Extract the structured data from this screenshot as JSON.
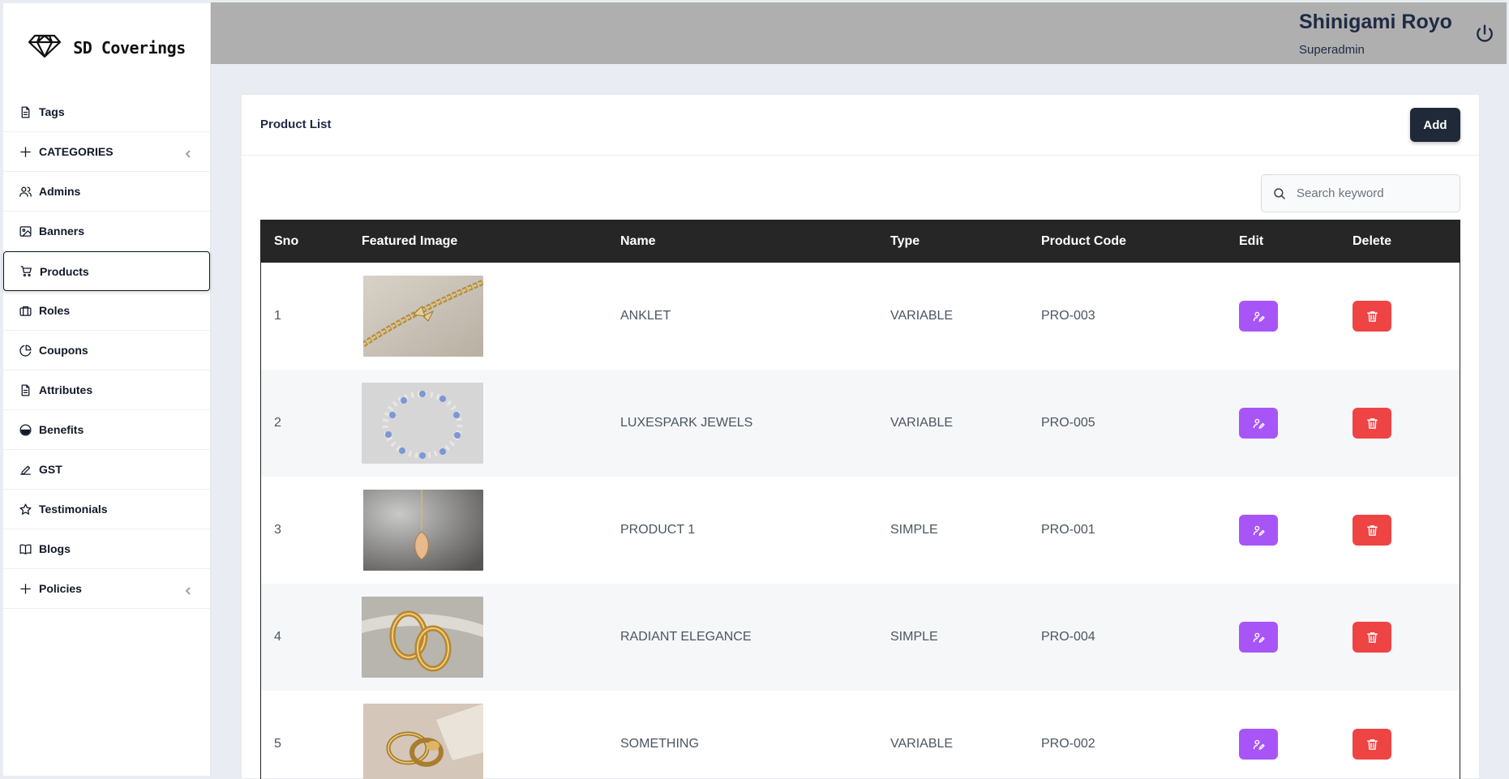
{
  "brand": {
    "name": "SD Coverings",
    "logo_icon": "diamond-icon"
  },
  "sidebar": {
    "items": [
      {
        "label": "Tags",
        "icon": "document-icon",
        "expandable": false
      },
      {
        "label": "CATEGORIES",
        "icon": "plus-icon",
        "expandable": true
      },
      {
        "label": "Admins",
        "icon": "users-icon",
        "expandable": false
      },
      {
        "label": "Banners",
        "icon": "image-icon",
        "expandable": false
      },
      {
        "label": "Products",
        "icon": "cart-icon",
        "expandable": false,
        "active": true
      },
      {
        "label": "Roles",
        "icon": "briefcase-icon",
        "expandable": false
      },
      {
        "label": "Coupons",
        "icon": "pie-chart-icon",
        "expandable": false
      },
      {
        "label": "Attributes",
        "icon": "document-icon",
        "expandable": false
      },
      {
        "label": "Benefits",
        "icon": "smile-icon",
        "expandable": false
      },
      {
        "label": "GST",
        "icon": "pen-icon",
        "expandable": false
      },
      {
        "label": "Testimonials",
        "icon": "star-icon",
        "expandable": false
      },
      {
        "label": "Blogs",
        "icon": "book-icon",
        "expandable": false
      },
      {
        "label": "Policies",
        "icon": "plus-icon",
        "expandable": true
      }
    ]
  },
  "header": {
    "user_name": "Shinigami Royo",
    "user_role": "Superadmin",
    "power_icon": "power-icon"
  },
  "main": {
    "title": "Product List",
    "add_label": "Add",
    "search": {
      "placeholder": "Search keyword",
      "value": ""
    },
    "columns": [
      "Sno",
      "Featured Image",
      "Name",
      "Type",
      "Product Code",
      "Edit",
      "Delete"
    ],
    "rows": [
      {
        "sno": "1",
        "image": "anklet-photo",
        "name": "ANKLET",
        "type": "VARIABLE",
        "code": "PRO-003"
      },
      {
        "sno": "2",
        "image": "bracelet-photo",
        "name": "LUXESPARK JEWELS",
        "type": "VARIABLE",
        "code": "PRO-005"
      },
      {
        "sno": "3",
        "image": "pendant-photo",
        "name": "PRODUCT 1",
        "type": "SIMPLE",
        "code": "PRO-001"
      },
      {
        "sno": "4",
        "image": "hoop-earrings-photo",
        "name": "RADIANT ELEGANCE",
        "type": "SIMPLE",
        "code": "PRO-004"
      },
      {
        "sno": "5",
        "image": "rings-photo",
        "name": "SOMETHING",
        "type": "VARIABLE",
        "code": "PRO-002"
      }
    ]
  },
  "colors": {
    "header_bg": "#afafaf",
    "table_head_bg": "#262626",
    "edit_button": "#a855f7",
    "delete_button": "#ef4444",
    "add_button": "#1f2937"
  }
}
